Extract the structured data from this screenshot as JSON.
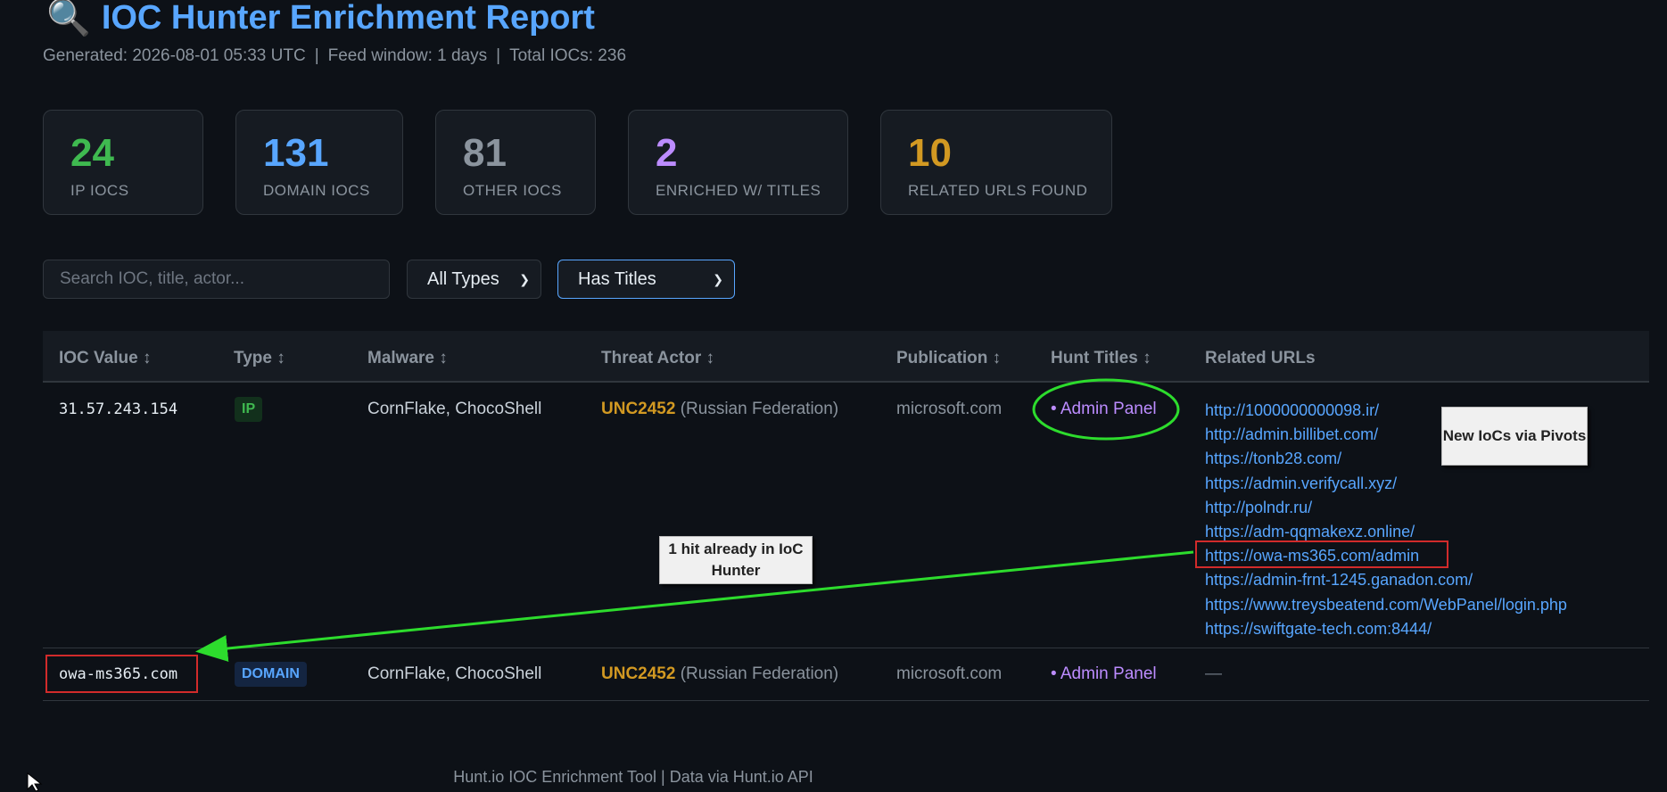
{
  "header": {
    "icon": "magnifier-icon",
    "title": "IOC Hunter Enrichment Report",
    "generated": "Generated: 2026-08-01 05:33 UTC",
    "feed_window": "Feed window: 1 days",
    "total": "Total IOCs: 236",
    "separator": "|"
  },
  "stats": [
    {
      "value": "24",
      "label": "IP IOCS",
      "color": "#3fb950"
    },
    {
      "value": "131",
      "label": "DOMAIN IOCS",
      "color": "#58a6ff"
    },
    {
      "value": "81",
      "label": "OTHER IOCS",
      "color": "#8b949e"
    },
    {
      "value": "2",
      "label": "ENRICHED W/ TITLES",
      "color": "#bc8cff"
    },
    {
      "value": "10",
      "label": "RELATED URLS FOUND",
      "color": "#d29922"
    }
  ],
  "filters": {
    "search_placeholder": "Search IOC, title, actor...",
    "type_select": "All Types",
    "title_select": "Has Titles"
  },
  "table": {
    "columns": [
      "IOC Value ↕",
      "Type ↕",
      "Malware ↕",
      "Threat Actor ↕",
      "Publication ↕",
      "Hunt Titles ↕",
      "Related URLs"
    ],
    "rows": [
      {
        "ioc": "31.57.243.154",
        "type": "IP",
        "malware": "CornFlake, ChocoShell",
        "actor": "UNC2452",
        "country": "(Russian Federation)",
        "publication": "microsoft.com",
        "hunt_title": "• Admin Panel",
        "related_urls": [
          "http://1000000000098.ir/",
          "http://admin.billibet.com/",
          "https://tonb28.com/",
          "https://admin.verifycall.xyz/",
          "http://polndr.ru/",
          "https://adm-qqmakexz.online/",
          "https://owa-ms365.com/admin",
          "https://admin-frnt-1245.ganadon.com/",
          "https://www.treysbeatend.com/WebPanel/login.php",
          "https://swiftgate-tech.com:8444/"
        ]
      },
      {
        "ioc": "owa-ms365.com",
        "type": "DOMAIN",
        "malware": "CornFlake, ChocoShell",
        "actor": "UNC2452",
        "country": "(Russian Federation)",
        "publication": "microsoft.com",
        "hunt_title": "• Admin Panel",
        "related_urls_empty": "—"
      }
    ]
  },
  "annotations": {
    "new_iocs": "New IoCs via Pivots",
    "hit": "1 hit already in IoC Hunter"
  },
  "footer": {
    "tool": "Hunt.io IOC Enrichment Tool",
    "separator": "|",
    "source": "Data via Hunt.io API"
  }
}
